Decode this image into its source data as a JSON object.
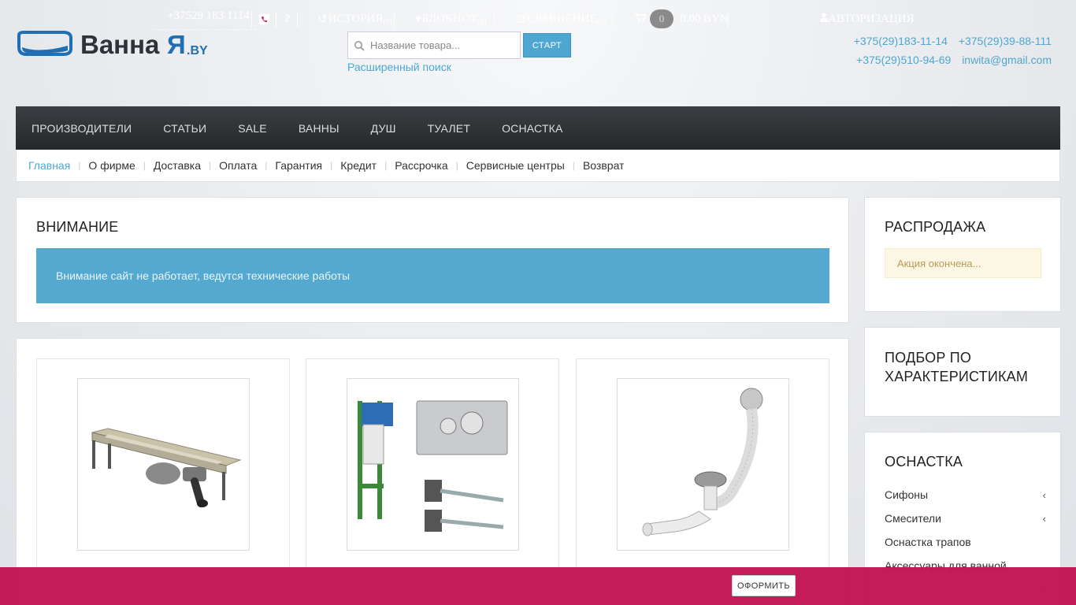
{
  "header": {
    "logo_text": "ВаннаЯ.by",
    "search_placeholder": "Название товара...",
    "search_button": "СТАРТ",
    "advanced_search": "Расширенный поиск",
    "phones": [
      "+375(29)183-11-14",
      "+375(29)39-88-111",
      "+375(29)510-94-69"
    ],
    "email": "inwita@gmail.com"
  },
  "nav": {
    "items": [
      "ПРОИЗВОДИТЕЛИ",
      "СТАТЬИ",
      "SALE",
      "ВАННЫ",
      "ДУШ",
      "ТУАЛЕТ",
      "ОСНАСТКА"
    ]
  },
  "subnav": {
    "items": [
      "Главная",
      "О фирме",
      "Доставка",
      "Оплата",
      "Гарантия",
      "Кредит",
      "Рассрочка",
      "Сервисные центры",
      "Возврат"
    ]
  },
  "notice": {
    "title": "ВНИМАНИЕ",
    "message": "Внимание сайт не работает, ведутся технические работы"
  },
  "sidebar": {
    "sale": {
      "title": "РАСПРОДАЖА",
      "note": "Акция окончена..."
    },
    "filter": {
      "title": "ПОДБОР ПО ХАРАКТЕРИСТИКАМ"
    },
    "osnastka": {
      "title": "ОСНАСТКА",
      "items": [
        {
          "label": "Сифоны",
          "chevron": true
        },
        {
          "label": "Смесители",
          "chevron": true
        },
        {
          "label": "Оснастка трапов",
          "chevron": false
        },
        {
          "label": "Аксессуары для ванной",
          "chevron": false
        },
        {
          "label": "",
          "chevron": true
        }
      ]
    }
  },
  "bottombar": {
    "phone": "+37529 183 1114",
    "history": "ИСТОРИЯ",
    "history_count": "(0)",
    "notepad": "БЛОКНОТ",
    "notepad_count": "(0)",
    "compare": "СРАВНЕНИЕ",
    "compare_count": "(0)",
    "cart_count": "0",
    "cart_total": "0.00 BYN",
    "checkout": "ОФОРМИТЬ",
    "auth": "АВТОРИЗАЦИЯ",
    "help": "?"
  },
  "colors": {
    "accent": "#4ea7d0",
    "nav_bg": "#2f3236",
    "bottom_bar": "#c21553",
    "alert_bg": "#54a9d0"
  }
}
